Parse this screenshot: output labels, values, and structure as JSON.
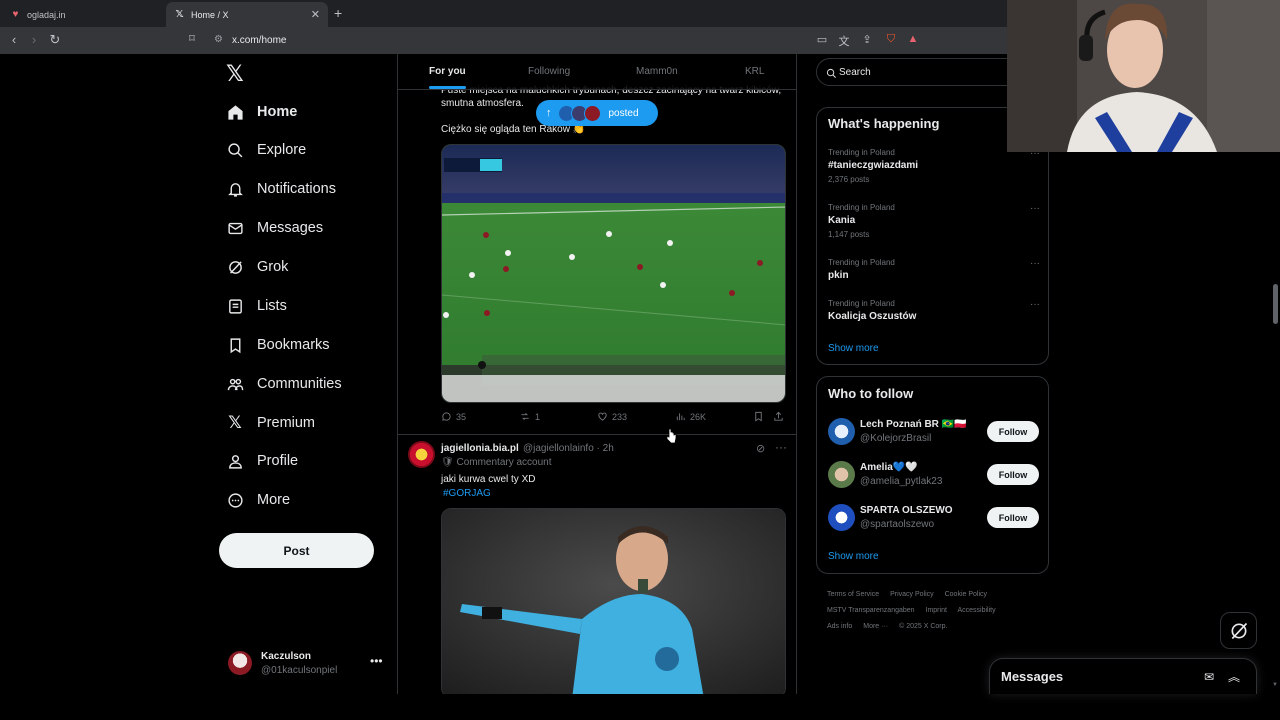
{
  "browser": {
    "tabs": [
      {
        "label": "ogladaj.in",
        "icon": "site-icon"
      },
      {
        "label": "Home / X",
        "icon": "x-icon",
        "active": true
      }
    ],
    "url": "x.com/home"
  },
  "sidebar": {
    "items": [
      {
        "label": "Home",
        "icon": "home-icon",
        "active": true
      },
      {
        "label": "Explore",
        "icon": "search-icon"
      },
      {
        "label": "Notifications",
        "icon": "bell-icon"
      },
      {
        "label": "Messages",
        "icon": "mail-icon"
      },
      {
        "label": "Grok",
        "icon": "grok-icon"
      },
      {
        "label": "Lists",
        "icon": "list-icon"
      },
      {
        "label": "Bookmarks",
        "icon": "bookmark-icon"
      },
      {
        "label": "Communities",
        "icon": "communities-icon"
      },
      {
        "label": "Premium",
        "icon": "x-icon"
      },
      {
        "label": "Profile",
        "icon": "person-icon"
      },
      {
        "label": "More",
        "icon": "more-circle-icon"
      }
    ],
    "post_label": "Post",
    "account": {
      "name": "Kaczulson",
      "handle": "@01kaculsonpiel"
    }
  },
  "timeline": {
    "tabs": [
      "For you",
      "Following",
      "Mamm0n",
      "KRL"
    ],
    "posted_pill": "posted",
    "tweet1": {
      "text_line1": "Puste miejsca na maluchkich trybunach, deszcz zacinający na twarz kibiców,",
      "text_line2": "smutna atmosfera.",
      "text_line3": "Ciężko się ogląda ten Raków 👏",
      "replies": "35",
      "retweets": "1",
      "likes": "233",
      "views": "26K"
    },
    "tweet2": {
      "name": "jagiellonia.bia.pl",
      "meta": "@jagiellonlainfo · 2h",
      "commentary": "🛡 Commentary account",
      "text": "jaki kurwa cwel ty XD",
      "hashtag": "#GORJAG"
    }
  },
  "right": {
    "search_placeholder": "Search",
    "happening_title": "What's happening",
    "trends": [
      {
        "context": "Trending in Poland",
        "name": "#tanieczgwiazdami",
        "count": "2,376 posts"
      },
      {
        "context": "Trending in Poland",
        "name": "Kania",
        "count": "1,147 posts"
      },
      {
        "context": "Trending in Poland",
        "name": "pkin",
        "count": ""
      },
      {
        "context": "Trending in Poland",
        "name": "Koalicja Oszustów",
        "count": ""
      }
    ],
    "show_more": "Show more",
    "who_title": "Who to follow",
    "follow": [
      {
        "name": "Lech Poznań BR 🇧🇷🇵🇱",
        "handle": "@KolejorzBrasil",
        "button": "Follow"
      },
      {
        "name": "Amelia💙🤍",
        "handle": "@amelia_pytlak23",
        "button": "Follow"
      },
      {
        "name": "SPARTA OLSZEWO",
        "handle": "@spartaolszewo",
        "button": "Follow"
      }
    ],
    "footer": [
      "Terms of Service",
      "Privacy Policy",
      "Cookie Policy",
      "MSTV Transparenzangaben",
      "Imprint",
      "Accessibility",
      "Ads info",
      "More ···",
      "© 2025 X Corp."
    ],
    "messages_label": "Messages"
  },
  "colors": {
    "accent": "#1d9bf0",
    "bg": "#000000",
    "border": "#2f3336",
    "muted": "#71767b"
  }
}
